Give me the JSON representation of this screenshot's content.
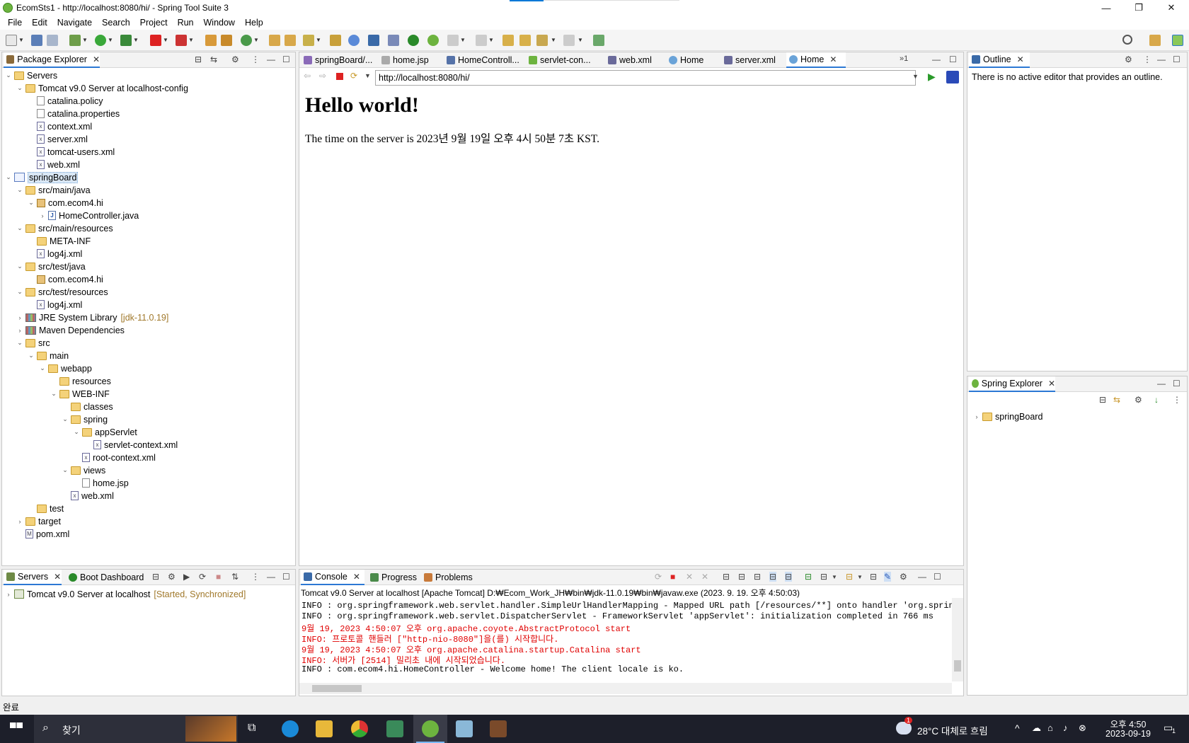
{
  "window": {
    "title": "EcomSts1 - http://localhost:8080/hi/ - Spring Tool Suite 3",
    "controls": {
      "minimize": "—",
      "restore": "❐",
      "close": "✕"
    }
  },
  "menu": [
    "File",
    "Edit",
    "Navigate",
    "Search",
    "Project",
    "Run",
    "Window",
    "Help"
  ],
  "package_explorer": {
    "tab_label": "Package Explorer",
    "tree": [
      {
        "label": "Servers",
        "depth": 0,
        "icon": "folder-open-icon",
        "twisty": "open"
      },
      {
        "label": "Tomcat v9.0 Server at localhost-config",
        "depth": 1,
        "icon": "folder-open-icon",
        "twisty": "open"
      },
      {
        "label": "catalina.policy",
        "depth": 2,
        "icon": "file-icon",
        "twisty": "none"
      },
      {
        "label": "catalina.properties",
        "depth": 2,
        "icon": "file-icon",
        "twisty": "none"
      },
      {
        "label": "context.xml",
        "depth": 2,
        "icon": "xml-file-icon",
        "twisty": "none"
      },
      {
        "label": "server.xml",
        "depth": 2,
        "icon": "xml-file-icon",
        "twisty": "none"
      },
      {
        "label": "tomcat-users.xml",
        "depth": 2,
        "icon": "xml-file-icon",
        "twisty": "none"
      },
      {
        "label": "web.xml",
        "depth": 2,
        "icon": "xml-file-icon",
        "twisty": "none"
      },
      {
        "label": "springBoard",
        "depth": 0,
        "icon": "project-icon",
        "twisty": "open",
        "selected": true
      },
      {
        "label": "src/main/java",
        "depth": 1,
        "icon": "source-folder-icon",
        "twisty": "open"
      },
      {
        "label": "com.ecom4.hi",
        "depth": 2,
        "icon": "package-icon",
        "twisty": "open"
      },
      {
        "label": "HomeController.java",
        "depth": 3,
        "icon": "java-file-icon",
        "twisty": "closed"
      },
      {
        "label": "src/main/resources",
        "depth": 1,
        "icon": "source-folder-icon",
        "twisty": "open"
      },
      {
        "label": "META-INF",
        "depth": 2,
        "icon": "folder-icon",
        "twisty": "none"
      },
      {
        "label": "log4j.xml",
        "depth": 2,
        "icon": "xml-file-icon",
        "twisty": "none"
      },
      {
        "label": "src/test/java",
        "depth": 1,
        "icon": "source-folder-icon",
        "twisty": "open"
      },
      {
        "label": "com.ecom4.hi",
        "depth": 2,
        "icon": "package-icon",
        "twisty": "none"
      },
      {
        "label": "src/test/resources",
        "depth": 1,
        "icon": "source-folder-icon",
        "twisty": "open"
      },
      {
        "label": "log4j.xml",
        "depth": 2,
        "icon": "xml-file-icon",
        "twisty": "none"
      },
      {
        "label": "JRE System Library",
        "decoration": "[jdk-11.0.19]",
        "depth": 1,
        "icon": "library-icon",
        "twisty": "closed"
      },
      {
        "label": "Maven Dependencies",
        "depth": 1,
        "icon": "library-icon",
        "twisty": "closed"
      },
      {
        "label": "src",
        "depth": 1,
        "icon": "folder-open-icon",
        "twisty": "open"
      },
      {
        "label": "main",
        "depth": 2,
        "icon": "folder-open-icon",
        "twisty": "open"
      },
      {
        "label": "webapp",
        "depth": 3,
        "icon": "folder-open-icon",
        "twisty": "open"
      },
      {
        "label": "resources",
        "depth": 4,
        "icon": "folder-icon",
        "twisty": "none"
      },
      {
        "label": "WEB-INF",
        "depth": 4,
        "icon": "folder-open-icon",
        "twisty": "open"
      },
      {
        "label": "classes",
        "depth": 5,
        "icon": "folder-icon",
        "twisty": "none"
      },
      {
        "label": "spring",
        "depth": 5,
        "icon": "folder-open-icon",
        "twisty": "open"
      },
      {
        "label": "appServlet",
        "depth": 6,
        "icon": "folder-open-icon",
        "twisty": "open"
      },
      {
        "label": "servlet-context.xml",
        "depth": 7,
        "icon": "spring-xml-icon",
        "twisty": "none"
      },
      {
        "label": "root-context.xml",
        "depth": 6,
        "icon": "spring-xml-icon",
        "twisty": "none"
      },
      {
        "label": "views",
        "depth": 5,
        "icon": "folder-open-icon",
        "twisty": "open"
      },
      {
        "label": "home.jsp",
        "depth": 6,
        "icon": "file-icon",
        "twisty": "none"
      },
      {
        "label": "web.xml",
        "depth": 5,
        "icon": "xml-file-icon",
        "twisty": "none"
      },
      {
        "label": "test",
        "depth": 2,
        "icon": "folder-icon",
        "twisty": "none"
      },
      {
        "label": "target",
        "depth": 1,
        "icon": "folder-icon",
        "twisty": "closed"
      },
      {
        "label": "pom.xml",
        "depth": 1,
        "icon": "maven-file-icon",
        "twisty": "none"
      }
    ]
  },
  "editor_tabs": [
    {
      "label": "springBoard/...",
      "icon": "maven-file-icon"
    },
    {
      "label": "home.jsp",
      "icon": "file-icon"
    },
    {
      "label": "HomeControll...",
      "icon": "java-file-icon"
    },
    {
      "label": "servlet-con...",
      "icon": "spring-xml-icon"
    },
    {
      "label": "web.xml",
      "icon": "xml-file-icon"
    },
    {
      "label": "Home",
      "icon": "globe-icon"
    },
    {
      "label": "server.xml",
      "icon": "xml-file-icon"
    },
    {
      "label": "Home",
      "icon": "globe-icon",
      "active": true
    }
  ],
  "editor_overflow": "»1",
  "browser": {
    "url": "http://localhost:8080/hi/",
    "heading": "Hello world!",
    "paragraph": "The time on the server is 2023년 9월 19일 오후 4시 50분 7초 KST."
  },
  "outline": {
    "tab_label": "Outline",
    "message": "There is no active editor that provides an outline."
  },
  "spring_explorer": {
    "tab_label": "Spring Explorer",
    "items": [
      "springBoard"
    ]
  },
  "servers_view": {
    "tabs": [
      "Servers",
      "Boot Dashboard"
    ],
    "server": "Tomcat v9.0 Server at localhost",
    "status": "[Started, Synchronized]"
  },
  "console": {
    "tabs": [
      "Console",
      "Progress",
      "Problems"
    ],
    "header": "Tomcat v9.0 Server at localhost [Apache Tomcat] D:₩Ecom_Work_JH₩bin₩jdk-11.0.19₩bin₩javaw.exe  (2023. 9. 19. 오후 4:50:03)",
    "lines": [
      {
        "text": "INFO : org.springframework.web.servlet.handler.SimpleUrlHandlerMapping - Mapped URL path [/resources/**] onto handler 'org.springfra",
        "color": "#000000"
      },
      {
        "text": "INFO : org.springframework.web.servlet.DispatcherServlet - FrameworkServlet 'appServlet': initialization completed in 766 ms",
        "color": "#000000"
      },
      {
        "text": "9월 19, 2023 4:50:07 오후 org.apache.coyote.AbstractProtocol start",
        "color": "#e00000"
      },
      {
        "text": "INFO: 프로토콜 핸들러 [\"http-nio-8080\"]을(를) 시작합니다.",
        "color": "#e00000"
      },
      {
        "text": "9월 19, 2023 4:50:07 오후 org.apache.catalina.startup.Catalina start",
        "color": "#e00000"
      },
      {
        "text": "INFO: 서버가 [2514] 밀리초 내에 시작되었습니다.",
        "color": "#e00000"
      },
      {
        "text": "INFO : com.ecom4.hi.HomeController - Welcome home! The client locale is ko.",
        "color": "#000000"
      }
    ]
  },
  "statusbar": {
    "text": "완료"
  },
  "taskbar": {
    "search_label": "찾기",
    "weather": "28°C  대체로 흐림",
    "weather_badge": "1",
    "time": "오후 4:50",
    "date": "2023-09-19",
    "notification_count": "1"
  },
  "colors": {
    "accent": "#2c78d4",
    "spring_green": "#6db33f",
    "console_red": "#e00000"
  }
}
